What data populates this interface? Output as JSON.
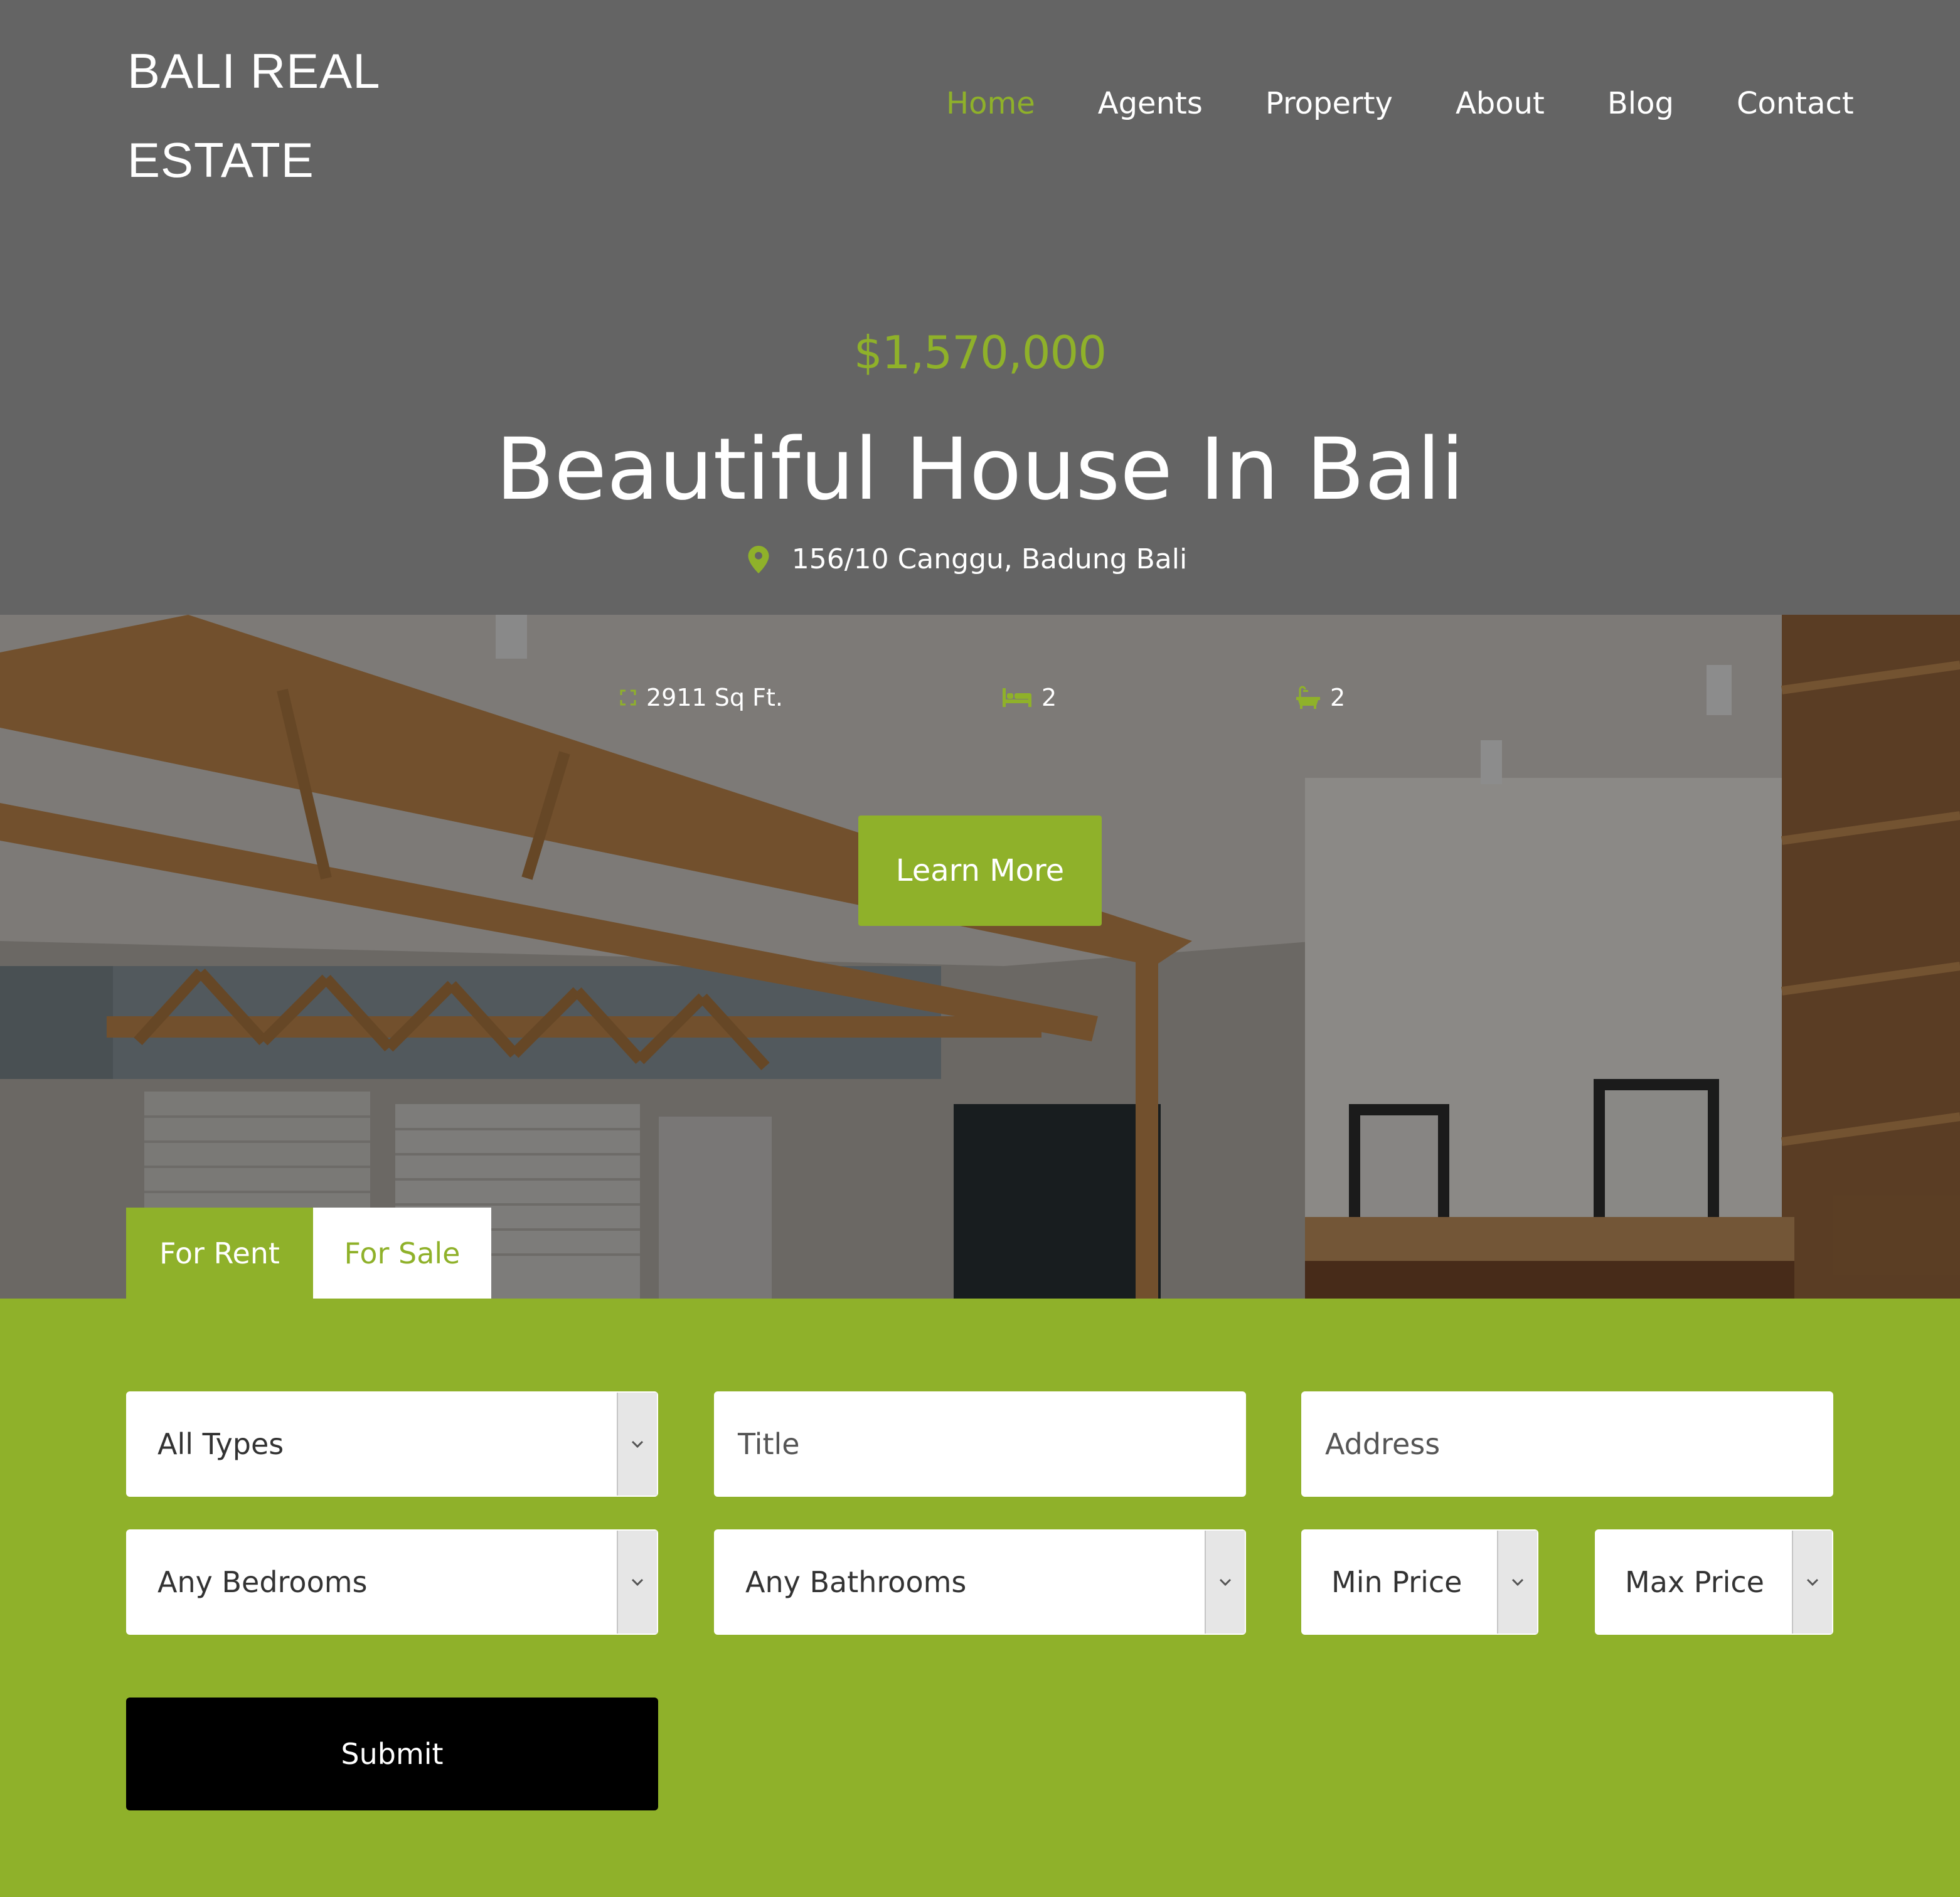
{
  "brand": {
    "line1": "BALI REAL",
    "line2": "ESTATE"
  },
  "nav": [
    {
      "label": "Home",
      "active": true
    },
    {
      "label": "Agents",
      "active": false
    },
    {
      "label": "Property",
      "active": false
    },
    {
      "label": "About",
      "active": false
    },
    {
      "label": "Blog",
      "active": false
    },
    {
      "label": "Contact",
      "active": false
    }
  ],
  "listing": {
    "price": "$1,570,000",
    "title": "Beautiful House In Bali",
    "address": "156/10 Canggu, Badung Bali",
    "area": "2911 Sq Ft.",
    "bedrooms": "2",
    "bathrooms": "2",
    "cta": "Learn More"
  },
  "tabs": {
    "rent": "For Rent",
    "sale": "For Sale"
  },
  "search": {
    "type_select": "All Types",
    "title_placeholder": "Title",
    "address_placeholder": "Address",
    "bedrooms_select": "Any Bedrooms",
    "bathrooms_select": "Any Bathrooms",
    "min_price_select": "Min Price",
    "max_price_select": "Max Price",
    "submit": "Submit"
  },
  "colors": {
    "accent": "#8fb12a",
    "header_bg": "#646464",
    "button_dark": "#000000"
  },
  "icons": [
    "map-pin-icon",
    "area-icon",
    "bed-icon",
    "bathtub-icon",
    "chevron-down-icon"
  ]
}
